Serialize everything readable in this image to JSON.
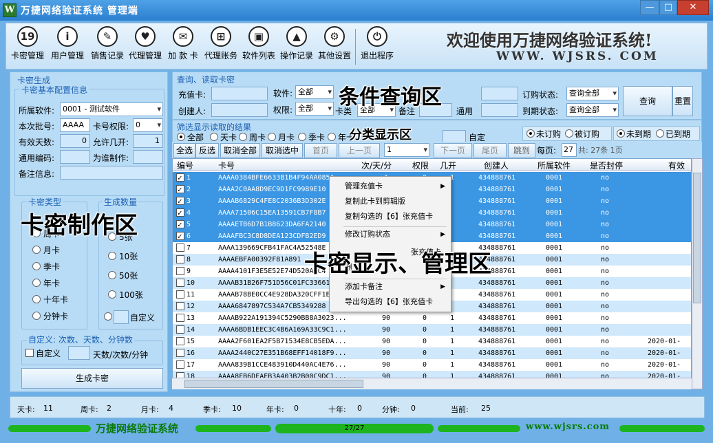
{
  "window": {
    "title": "万捷网络验证系统 管理端",
    "app_icon": "W",
    "minimize": "—",
    "maximize": "□",
    "close": "✕"
  },
  "toolbar": {
    "items": [
      {
        "label": "卡密管理",
        "icon": "calendar-icon",
        "glyph": "19"
      },
      {
        "label": "用户管理",
        "icon": "info-icon",
        "glyph": "i"
      },
      {
        "label": "销售记录",
        "icon": "pin-icon",
        "glyph": "✎"
      },
      {
        "label": "代理管理",
        "icon": "heart-icon",
        "glyph": "♥"
      },
      {
        "label": "加 款 卡",
        "icon": "mail-icon",
        "glyph": "✉"
      },
      {
        "label": "代理账务",
        "icon": "windows-icon",
        "glyph": "⊞"
      },
      {
        "label": "软件列表",
        "icon": "disk-icon",
        "glyph": "▣"
      },
      {
        "label": "操作记录",
        "icon": "navigation-icon",
        "glyph": "▲"
      },
      {
        "label": "其他设置",
        "icon": "gear-icon",
        "glyph": "⚙"
      },
      {
        "label": "退出程序",
        "icon": "power-icon",
        "glyph": "⏻"
      }
    ]
  },
  "banner": {
    "welcome": "欢迎使用万捷网络验证系统!",
    "url": "WWW. WJSRS. COM"
  },
  "left": {
    "section_title": "卡密生成",
    "config_title": "卡密基本配置信息",
    "software_label": "所属软件:",
    "software_value": "0001 - 测试软件",
    "batch_label": "本次批号:",
    "batch_value": "AAAA",
    "perm_label": "卡号权限:",
    "perm_value": "0",
    "days_label": "有效天数:",
    "days_value": "0",
    "allow_label": "允许几开:",
    "allow_value": "1",
    "code_label": "通用编码:",
    "code_value": "",
    "for_label": "为谁制作:",
    "for_value": "",
    "note_label": "备注信息:",
    "note_value": "",
    "type_title": "卡密类型",
    "count_title": "生成数量",
    "types": [
      "周卡",
      "月卡",
      "季卡",
      "年卡",
      "十年卡",
      "分钟卡"
    ],
    "counts": [
      "5张",
      "10张",
      "50张",
      "100张"
    ],
    "custom_count": "自定义",
    "custom_title": "自定义: 次数、天数、分钟数",
    "custom_chk": "自定义",
    "custom_unit": "天数/次数/分钟",
    "generate": "生成卡密"
  },
  "query": {
    "title": "查询、读取卡密",
    "card_label": "充值卡:",
    "software_label": "软件:",
    "software_value": "全部",
    "order_label": "订购状态:",
    "order_value": "查询全部",
    "creator_label": "创建人:",
    "perm_label": "权限:",
    "perm_value": "全部",
    "type_label": "卡类",
    "type_value": "全部",
    "note_label": "备注",
    "general_label": "通用",
    "expire_label": "到期状态:",
    "expire_value": "查询全部",
    "query_btn": "查询",
    "reset_btn": "重置"
  },
  "filter": {
    "title": "筛选显示读取的结果",
    "types": [
      "全部",
      "天卡",
      "周卡",
      "月卡",
      "季卡",
      "年卡"
    ],
    "custom": "自定",
    "order": [
      "未订购",
      "被订购"
    ],
    "expire": [
      "未到期",
      "已到期"
    ]
  },
  "actions": {
    "select_all": "全选",
    "invert": "反选",
    "cancel_all": "取消全部",
    "cancel_selected": "取消选中",
    "first": "首页",
    "prev": "上一页",
    "page": "1",
    "next": "下一页",
    "last": "尾页",
    "jump": "跳到",
    "per_page_label": "每页:",
    "per_page": "27",
    "total": "共: 27条 1页"
  },
  "grid": {
    "headers": [
      "编号",
      "卡号",
      "次/天/分",
      "权限",
      "几开",
      "创建人",
      "所属软件",
      "是否封停",
      "有效"
    ],
    "rows": [
      {
        "n": "1",
        "card": "AAAA0384BFE6633B1B4F94AA085A",
        "d": "1",
        "p": "0",
        "k": "1",
        "c": "434888761",
        "s": "0001",
        "f": "no",
        "e": "",
        "checked": true,
        "sel": true
      },
      {
        "n": "2",
        "card": "AAAA2C0AA8D9EC9D1FC9989E10",
        "d": "",
        "p": "",
        "k": "",
        "c": "434888761",
        "s": "0001",
        "f": "no",
        "e": "",
        "checked": true,
        "sel": true
      },
      {
        "n": "3",
        "card": "AAAAB6829C4FE8C2036B3D302E",
        "d": "",
        "p": "",
        "k": "",
        "c": "434888761",
        "s": "0001",
        "f": "no",
        "e": "",
        "checked": true,
        "sel": true
      },
      {
        "n": "4",
        "card": "AAAA71506C15EA13591CB7F8B7",
        "d": "",
        "p": "",
        "k": "",
        "c": "434888761",
        "s": "0001",
        "f": "no",
        "e": "",
        "checked": true,
        "sel": true
      },
      {
        "n": "5",
        "card": "AAAAETB6D7B1B8623DA6FA2140",
        "d": "",
        "p": "",
        "k": "",
        "c": "434888761",
        "s": "0001",
        "f": "no",
        "e": "",
        "checked": true,
        "sel": true
      },
      {
        "n": "6",
        "card": "AAAAFBC3C8D8DEA123CDFB2ED9",
        "d": "",
        "p": "",
        "k": "",
        "c": "434888761",
        "s": "0001",
        "f": "no",
        "e": "",
        "checked": true,
        "sel": true
      },
      {
        "n": "7",
        "card": "AAAA139669CFB41FAC4A52548E",
        "d": "",
        "p": "",
        "k": "",
        "c": "434888761",
        "s": "0001",
        "f": "no",
        "e": "",
        "checked": false,
        "sel": false
      },
      {
        "n": "8",
        "card": "AAAAEBFA00392F81A891",
        "d": "",
        "p": "",
        "k": "",
        "c": "434888761",
        "s": "0001",
        "f": "no",
        "e": "",
        "checked": false,
        "sel": false
      },
      {
        "n": "9",
        "card": "AAAA4101F3E5E52E74D520A3C4",
        "d": "",
        "p": "",
        "k": "",
        "c": "434888761",
        "s": "0001",
        "f": "no",
        "e": "",
        "checked": false,
        "sel": false
      },
      {
        "n": "10",
        "card": "AAAAB31B26F751D56C01FC33661",
        "d": "",
        "p": "",
        "k": "",
        "c": "434888761",
        "s": "0001",
        "f": "no",
        "e": "",
        "checked": false,
        "sel": false
      },
      {
        "n": "11",
        "card": "AAAAB78BE0CC4E928DA320CFF1E",
        "d": "",
        "p": "",
        "k": "",
        "c": "434888761",
        "s": "0001",
        "f": "no",
        "e": "",
        "checked": false,
        "sel": false
      },
      {
        "n": "12",
        "card": "AAAA6847897C534A7CB5349288",
        "d": "",
        "p": "",
        "k": "",
        "c": "434888761",
        "s": "0001",
        "f": "no",
        "e": "",
        "checked": false,
        "sel": false
      },
      {
        "n": "13",
        "card": "AAAAB922A191394C5290BB8A3023...",
        "d": "90",
        "p": "0",
        "k": "1",
        "c": "434888761",
        "s": "0001",
        "f": "no",
        "e": "",
        "checked": false,
        "sel": false
      },
      {
        "n": "14",
        "card": "AAAA6BDB1EEC3C4B6A169A33C9C1...",
        "d": "90",
        "p": "0",
        "k": "1",
        "c": "434888761",
        "s": "0001",
        "f": "no",
        "e": "",
        "checked": false,
        "sel": false
      },
      {
        "n": "15",
        "card": "AAAA2F601EA2F5B71534E8CB5EDA...",
        "d": "90",
        "p": "0",
        "k": "1",
        "c": "434888761",
        "s": "0001",
        "f": "no",
        "e": "2020-01-",
        "checked": false,
        "sel": false
      },
      {
        "n": "16",
        "card": "AAAA2440C27E351B68EFF14018F9...",
        "d": "90",
        "p": "0",
        "k": "1",
        "c": "434888761",
        "s": "0001",
        "f": "no",
        "e": "2020-01-",
        "checked": false,
        "sel": false
      },
      {
        "n": "17",
        "card": "AAAA839B1CCE483910D440AC4E76...",
        "d": "90",
        "p": "0",
        "k": "1",
        "c": "434888761",
        "s": "0001",
        "f": "no",
        "e": "2020-01-",
        "checked": false,
        "sel": false
      },
      {
        "n": "18",
        "card": "AAAA8FB6DFAEB3A403B2B00C9DC1...",
        "d": "90",
        "p": "0",
        "k": "1",
        "c": "434888761",
        "s": "0001",
        "f": "no",
        "e": "2020-01-",
        "checked": false,
        "sel": false
      }
    ]
  },
  "context_menu": {
    "items": [
      {
        "label": "管理充值卡",
        "sub": true
      },
      {
        "label": "复制此卡到剪辑版",
        "sub": false
      },
      {
        "label": "复制勾选的【6】张充值卡",
        "sub": false
      },
      {
        "label": "修改订购状态",
        "sub": true
      },
      {
        "label": "",
        "sub": false
      },
      {
        "label": "",
        "sub": false
      },
      {
        "label": "添加卡备注",
        "sub": true
      },
      {
        "label": "导出勾选的【6】张充值卡",
        "sub": false
      }
    ],
    "obscured": [
      "张充值卡",
      "删",
      "卡",
      "手"
    ]
  },
  "overlays": {
    "query": "条件查询区",
    "filter": "分类显示区",
    "make": "卡密制作区",
    "display": "卡密显示、管理区"
  },
  "status": {
    "items": [
      {
        "label": "天卡:",
        "value": "11"
      },
      {
        "label": "周卡:",
        "value": "2"
      },
      {
        "label": "月卡:",
        "value": "4"
      },
      {
        "label": "季卡:",
        "value": "10"
      },
      {
        "label": "年卡:",
        "value": "0"
      },
      {
        "label": "十年:",
        "value": "0"
      },
      {
        "label": "分钟:",
        "value": "0"
      },
      {
        "label": "当前:",
        "value": "25"
      }
    ]
  },
  "footer": {
    "name": "万捷网络验证系统",
    "page": "27/27",
    "url": "www.wjsrs.com"
  },
  "colors": {
    "selection": "#3b96e3",
    "accent_green": "#1db41d",
    "panel": "#b9dcf6"
  }
}
